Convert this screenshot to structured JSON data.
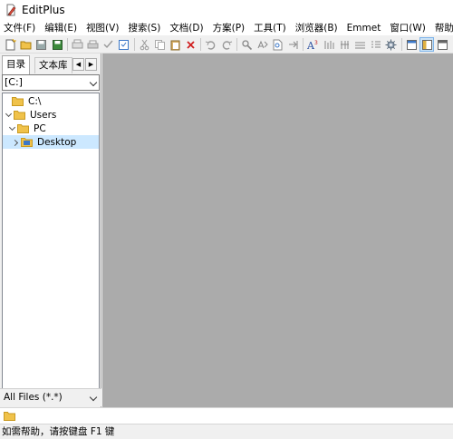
{
  "window": {
    "title": "EditPlus"
  },
  "menubar": {
    "items": [
      {
        "label": "文件(F)"
      },
      {
        "label": "编辑(E)"
      },
      {
        "label": "视图(V)"
      },
      {
        "label": "搜索(S)"
      },
      {
        "label": "文档(D)"
      },
      {
        "label": "方案(P)"
      },
      {
        "label": "工具(T)"
      },
      {
        "label": "浏览器(B)"
      },
      {
        "label": "Emmet"
      },
      {
        "label": "窗口(W)"
      },
      {
        "label": "帮助(H)"
      }
    ]
  },
  "sidebar": {
    "tabs": [
      {
        "label": "目录",
        "active": true
      },
      {
        "label": "文本库",
        "active": false
      }
    ],
    "drive": {
      "value": "[C:]"
    },
    "tree": [
      {
        "label": "C:\\",
        "indent": 0,
        "expander": "none",
        "selected": false
      },
      {
        "label": "Users",
        "indent": 0,
        "expander": "down",
        "selected": false
      },
      {
        "label": "PC",
        "indent": 1,
        "expander": "down",
        "selected": false
      },
      {
        "label": "Desktop",
        "indent": 2,
        "expander": "right",
        "selected": true
      }
    ],
    "filter": {
      "value": "All Files (*.*)"
    }
  },
  "statusbar": {
    "text": "如需帮助，请按键盘 F1 键"
  },
  "colors": {
    "editor_background": "#ababab",
    "selection": "#cce8ff",
    "folder": "#f0c24a"
  }
}
